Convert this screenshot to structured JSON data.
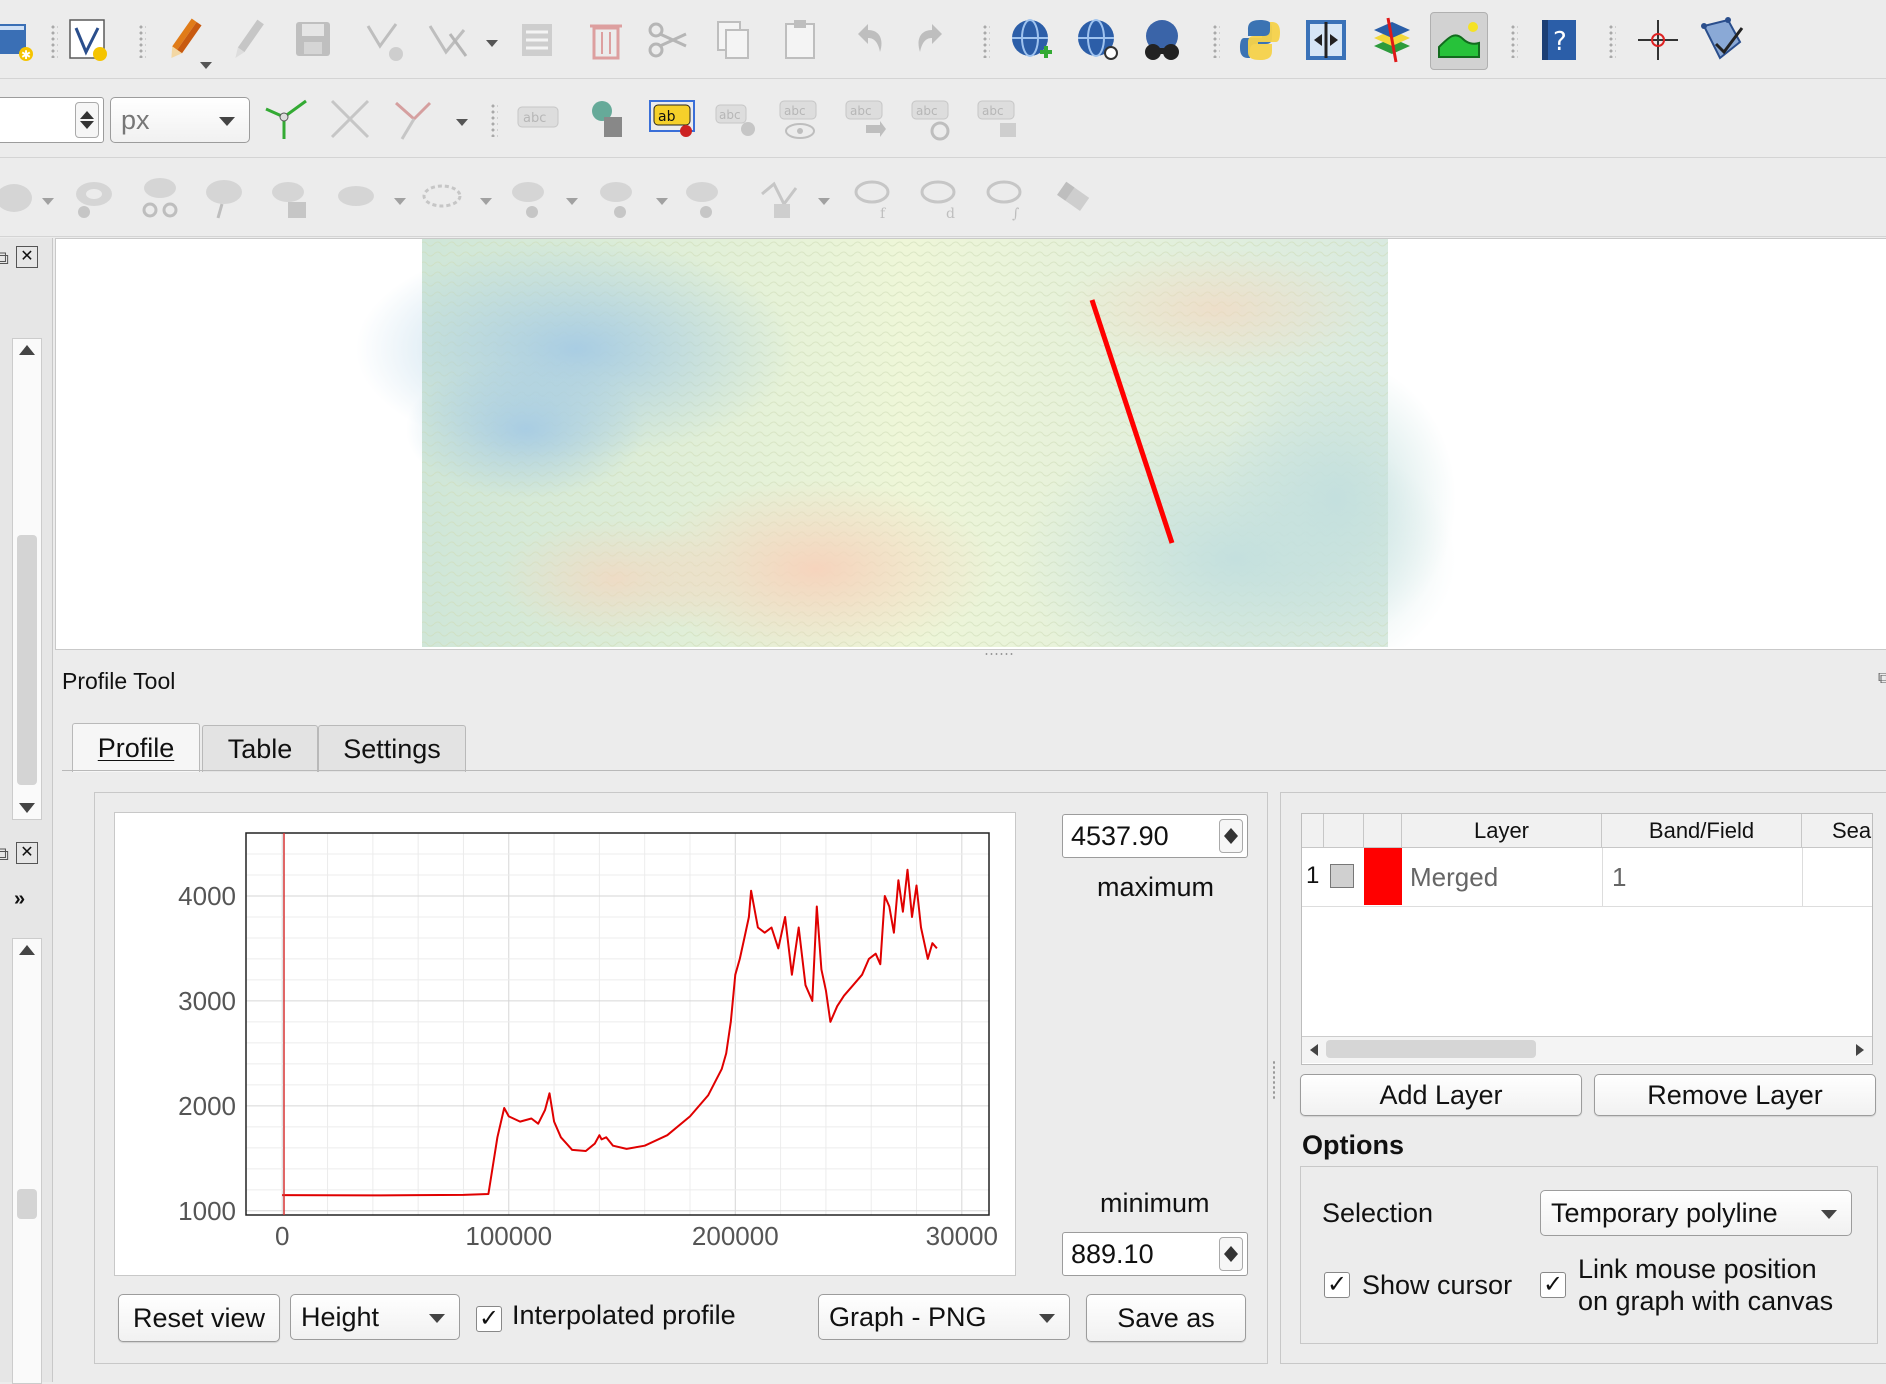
{
  "toolbar_row2": {
    "size_unit": "px"
  },
  "map": {
    "profile_line_color": "#ff0000"
  },
  "profile_dock": {
    "title": "Profile Tool",
    "tabs": [
      {
        "label": "Profile"
      },
      {
        "label": "Table"
      },
      {
        "label": "Settings"
      }
    ],
    "maximum_value": "4537.90",
    "maximum_label": "maximum",
    "minimum_label": "minimum",
    "minimum_value": "889.10",
    "reset_view_label": "Reset view",
    "height_combo": "Height",
    "interpolated_label": "Interpolated profile",
    "interpolated_checked": true,
    "export_combo": "Graph - PNG",
    "save_as_label": "Save as"
  },
  "layers_table": {
    "headers": [
      "Layer",
      "Band/Field",
      "Sear"
    ],
    "rows": [
      {
        "index": "1",
        "color": "#ff0000",
        "layer": "Merged",
        "band": "1"
      }
    ]
  },
  "layer_buttons": {
    "add": "Add Layer",
    "remove": "Remove Layer"
  },
  "options": {
    "title": "Options",
    "selection_label": "Selection",
    "selection_value": "Temporary polyline",
    "show_cursor_label": "Show cursor",
    "show_cursor_checked": true,
    "link_label_line1": "Link mouse position",
    "link_label_line2": "on graph with canvas",
    "link_checked": true
  },
  "chart_data": {
    "type": "line",
    "title": "",
    "xlabel": "",
    "ylabel": "",
    "x_ticks": [
      "0",
      "100000",
      "200000",
      "30000"
    ],
    "y_ticks": [
      "4000",
      "3000",
      "2000",
      "1000"
    ],
    "xlim": [
      -16000,
      312000
    ],
    "ylim": [
      960,
      4600
    ],
    "grid": true,
    "series": [
      {
        "color": "#e00000",
        "x": [
          0,
          20000,
          40000,
          60000,
          80000,
          91000,
          95000,
          98000,
          100000,
          105000,
          110000,
          113000,
          116000,
          118000,
          120000,
          123000,
          128000,
          134000,
          138000,
          140000,
          141000,
          143000,
          146000,
          152000,
          160000,
          170000,
          180000,
          188000,
          194000,
          196000,
          198000,
          200000,
          202000,
          204000,
          206000,
          207000,
          210000,
          213000,
          216000,
          219000,
          222000,
          225000,
          228000,
          231000,
          234000,
          236000,
          238000,
          240000,
          242000,
          245000,
          248000,
          252000,
          256000,
          259000,
          262000,
          264000,
          266000,
          268000,
          270000,
          272000,
          274000,
          276000,
          278000,
          280000,
          282000,
          285000,
          287000,
          289000
        ],
        "y": [
          1150,
          1148,
          1147,
          1150,
          1152,
          1160,
          1700,
          1980,
          1900,
          1850,
          1880,
          1830,
          1960,
          2120,
          1850,
          1700,
          1580,
          1570,
          1640,
          1720,
          1680,
          1700,
          1620,
          1590,
          1620,
          1720,
          1900,
          2100,
          2350,
          2500,
          2800,
          3250,
          3400,
          3600,
          3800,
          4050,
          3700,
          3650,
          3700,
          3500,
          3800,
          3250,
          3700,
          3150,
          3000,
          3900,
          3300,
          3100,
          2800,
          2950,
          3050,
          3150,
          3250,
          3400,
          3450,
          3350,
          4000,
          3900,
          3650,
          4150,
          3850,
          4250,
          3800,
          4100,
          3700,
          3400,
          3550,
          3500
        ]
      }
    ]
  }
}
